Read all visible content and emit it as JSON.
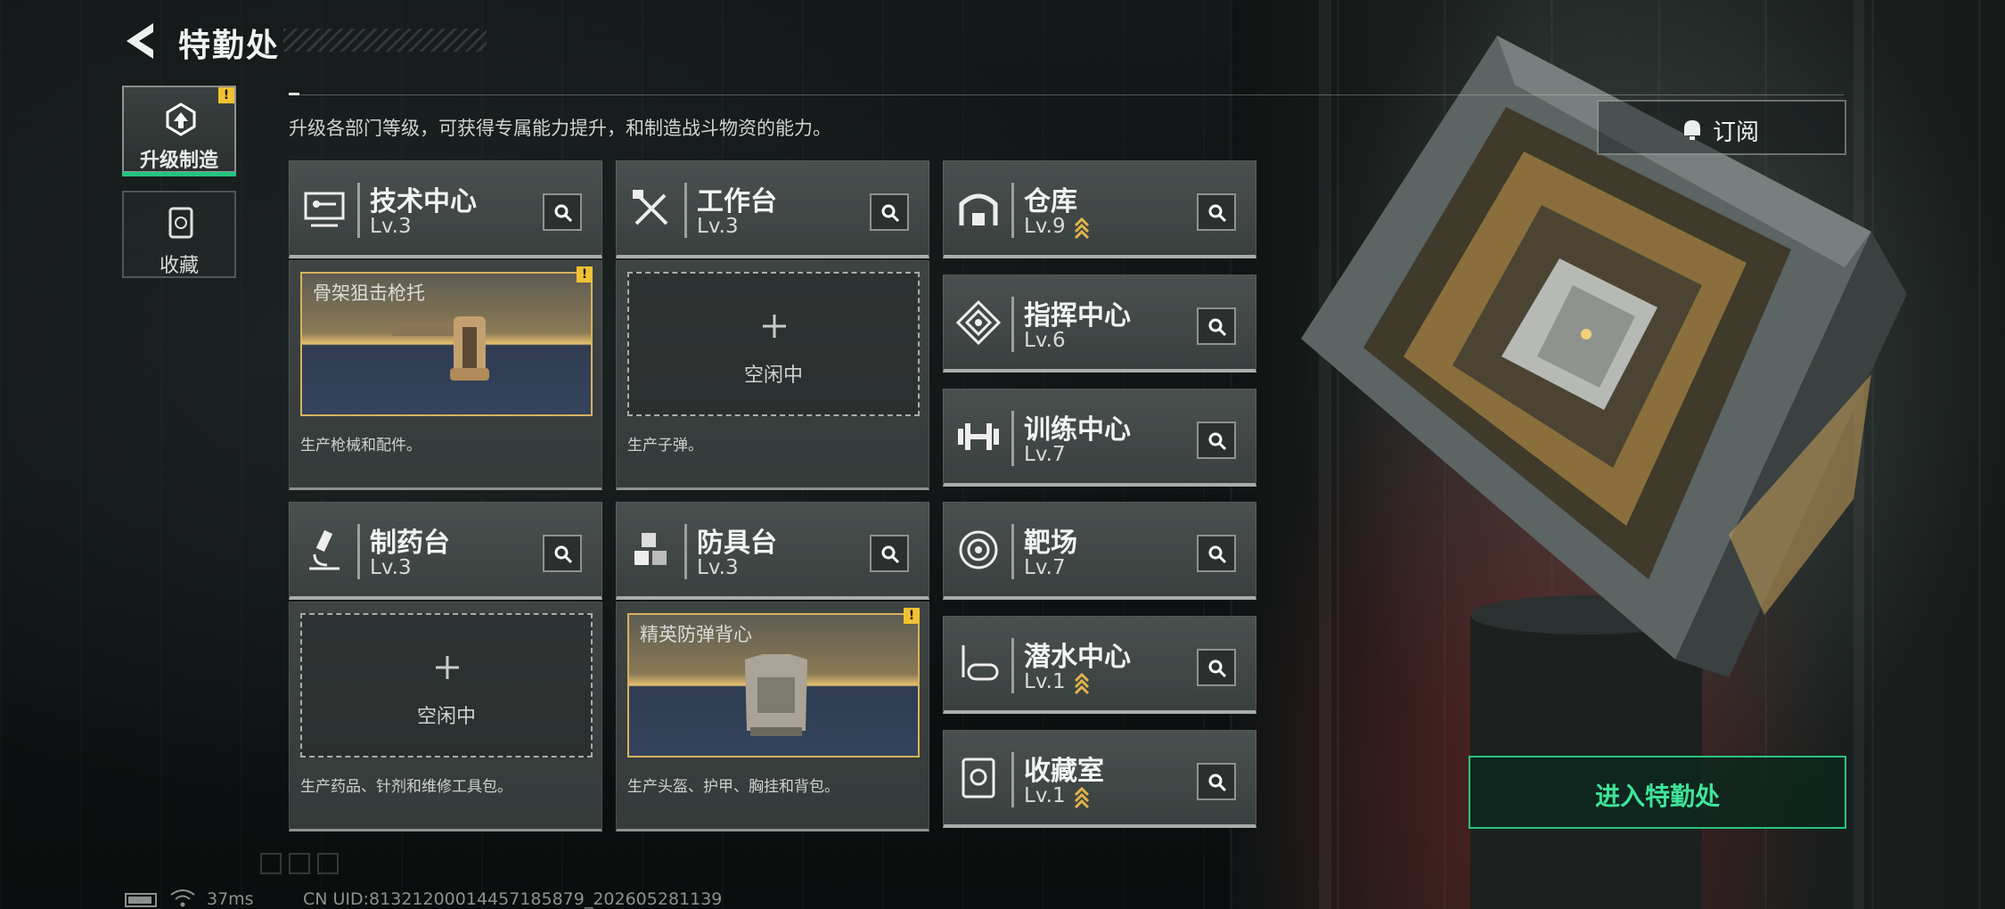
{
  "header": {
    "title": "特勤处",
    "description": "升级各部门等级，可获得专属能力提升，和制造战斗物资的能力。"
  },
  "nav": [
    {
      "label": "升级制造",
      "icon": "upgrade-craft-icon",
      "active": true,
      "warning": "!"
    },
    {
      "label": "收藏",
      "icon": "collection-icon",
      "active": false
    }
  ],
  "facilities": [
    {
      "id": "tech-center",
      "name": "技术中心",
      "level": "Lv.3",
      "icon": "monitor-icon"
    },
    {
      "id": "workbench",
      "name": "工作台",
      "level": "Lv.3",
      "icon": "tools-icon"
    },
    {
      "id": "warehouse",
      "name": "仓库",
      "level": "Lv.9",
      "icon": "warehouse-icon",
      "rank": true
    },
    {
      "id": "command-center",
      "name": "指挥中心",
      "level": "Lv.6",
      "icon": "command-icon"
    },
    {
      "id": "training-center",
      "name": "训练中心",
      "level": "Lv.7",
      "icon": "dumbbell-icon"
    },
    {
      "id": "pharmacy",
      "name": "制药台",
      "level": "Lv.3",
      "icon": "microscope-icon"
    },
    {
      "id": "armor-bench",
      "name": "防具台",
      "level": "Lv.3",
      "icon": "cubes-icon"
    },
    {
      "id": "shooting-range",
      "name": "靶场",
      "level": "Lv.7",
      "icon": "target-icon"
    },
    {
      "id": "diving-center",
      "name": "潜水中心",
      "level": "Lv.1",
      "icon": "diving-mask-icon",
      "rank": true
    },
    {
      "id": "collection-room",
      "name": "收藏室",
      "level": "Lv.1",
      "icon": "vault-icon",
      "rank": true
    }
  ],
  "production": {
    "tech_center": {
      "status": "filled",
      "item_name": "骨架狙击枪托",
      "warning": "!",
      "description": "生产枪械和配件。"
    },
    "workbench": {
      "status": "empty",
      "idle_label": "空闲中",
      "description": "生产子弹。"
    },
    "pharmacy": {
      "status": "empty",
      "idle_label": "空闲中",
      "description": "生产药品、针剂和维修工具包。"
    },
    "armor_bench": {
      "status": "filled",
      "item_name": "精英防弹背心",
      "warning": "!",
      "description": "生产头盔、护甲、胸挂和背包。"
    }
  },
  "actions": {
    "subscribe_label": "订阅",
    "enter_label": "进入特勤处"
  },
  "footer": {
    "ping": "37ms",
    "uid": "CN UID:81321200014457185879_202605281139"
  },
  "colors": {
    "accent_green": "#29c47f",
    "warning_yellow": "#f1c232",
    "rank_gold": "#e0b54a"
  }
}
